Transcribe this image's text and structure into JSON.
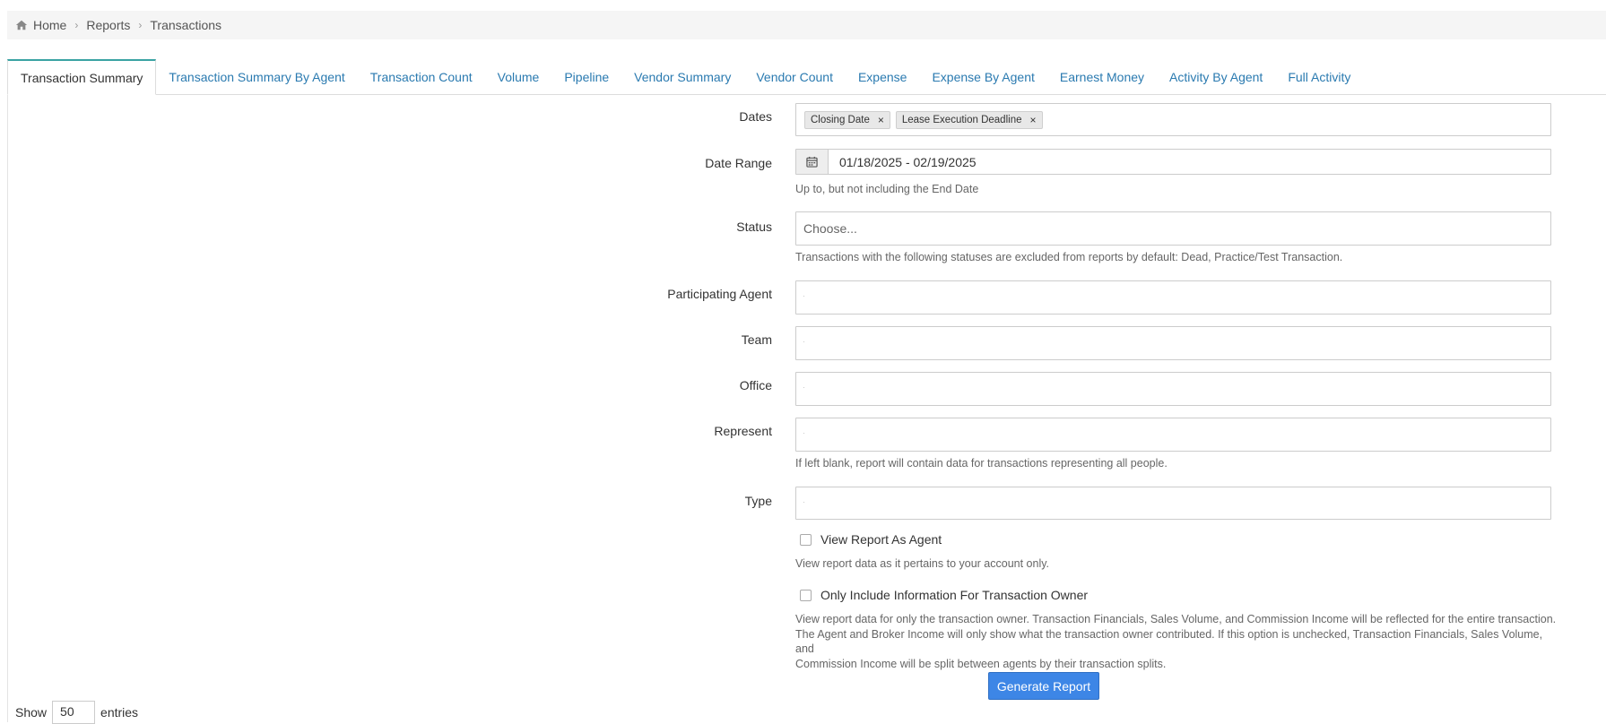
{
  "breadcrumb": {
    "home_icon": "home-icon",
    "home": "Home",
    "reports": "Reports",
    "current": "Transactions"
  },
  "tabs": [
    {
      "label": "Transaction Summary",
      "active": true
    },
    {
      "label": "Transaction Summary By Agent"
    },
    {
      "label": "Transaction Count"
    },
    {
      "label": "Volume"
    },
    {
      "label": "Pipeline"
    },
    {
      "label": "Vendor Summary"
    },
    {
      "label": "Vendor Count"
    },
    {
      "label": "Expense"
    },
    {
      "label": "Expense By Agent"
    },
    {
      "label": "Earnest Money"
    },
    {
      "label": "Activity By Agent"
    },
    {
      "label": "Full Activity"
    }
  ],
  "form": {
    "dates": {
      "label": "Dates",
      "tags": [
        {
          "text": "Closing Date",
          "remove": "×"
        },
        {
          "text": "Lease Execution Deadline",
          "remove": "×"
        }
      ]
    },
    "date_range": {
      "label": "Date Range",
      "icon": "calendar-icon",
      "value": "01/18/2025 - 02/19/2025",
      "help": "Up to, but not including the End Date"
    },
    "status": {
      "label": "Status",
      "placeholder": "Choose...",
      "help": "Transactions with the following statuses are excluded from reports by default: Dead, Practice/Test Transaction."
    },
    "participating_agent": {
      "label": "Participating Agent"
    },
    "team": {
      "label": "Team"
    },
    "office": {
      "label": "Office"
    },
    "represent": {
      "label": "Represent",
      "help": "If left blank, report will contain data for transactions representing all people."
    },
    "type": {
      "label": "Type"
    },
    "view_as_agent": {
      "label": "View Report As Agent",
      "checked": false,
      "help": "View report data as it pertains to your account only."
    },
    "owner_only": {
      "label": "Only Include Information For Transaction Owner",
      "checked": false,
      "help_line1": "View report data for only the transaction owner. Transaction Financials, Sales Volume, and Commission Income will be reflected for the entire transaction.",
      "help_line2": "The Agent and Broker Income will only show what the transaction owner contributed. If this option is unchecked, Transaction Financials, Sales Volume, and",
      "help_line3": "Commission Income will be split between agents by their transaction splits."
    },
    "generate_button": "Generate Report"
  },
  "entries": {
    "show": "Show",
    "value": "50",
    "suffix": "entries"
  },
  "colors": {
    "link": "#2a7ab0",
    "active_tab_accent": "#3aa3a3",
    "primary_button": "#3d86e6"
  }
}
